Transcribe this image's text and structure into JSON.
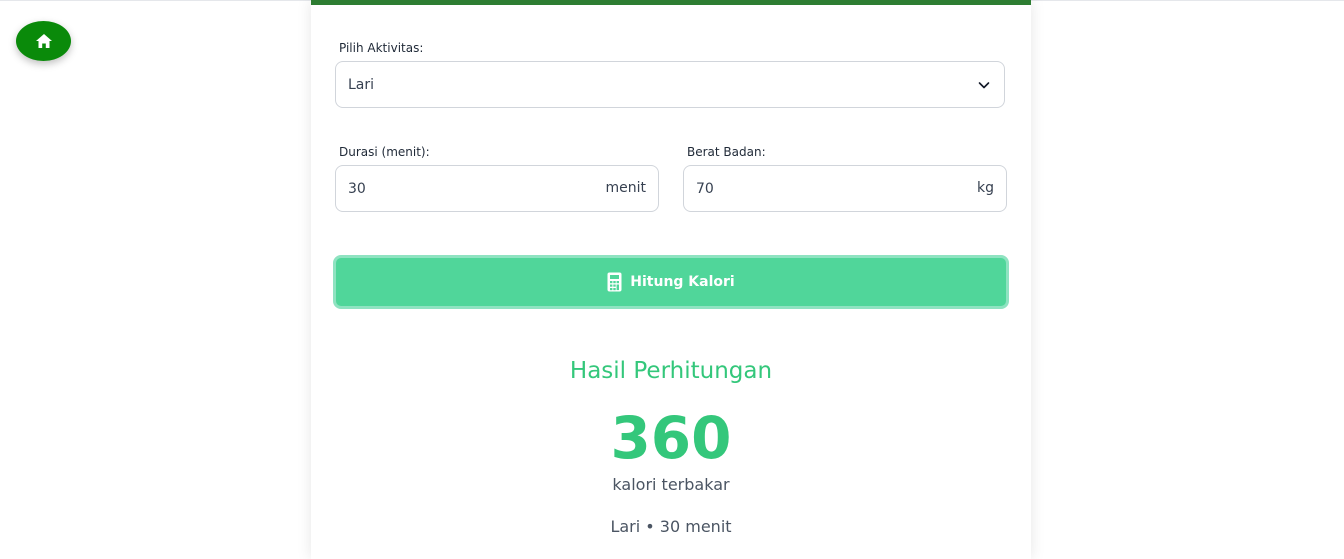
{
  "form": {
    "activity_label": "Pilih Aktivitas:",
    "activity_value": "Lari",
    "duration_label": "Durasi (menit):",
    "duration_value": "30",
    "duration_unit": "menit",
    "weight_label": "Berat Badan:",
    "weight_value": "70",
    "weight_unit": "kg",
    "calculate_label": "Hitung Kalori"
  },
  "result": {
    "title": "Hasil Perhitungan",
    "calories": "360",
    "unit_text": "kalori terbakar",
    "summary": "Lari • 30 menit"
  },
  "colors": {
    "home_button": "#0a8a0a",
    "card_top_border": "#2e7d32",
    "button": "#50d69a",
    "result_accent": "#34c77b"
  },
  "icons": {
    "home": "home-icon",
    "select_chevron": "chevron-down-icon",
    "calculator": "calculator-icon"
  }
}
